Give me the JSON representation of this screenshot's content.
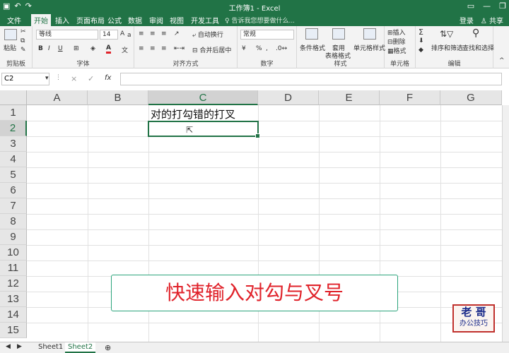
{
  "titlebar": {
    "save_icon": "save-icon",
    "undo": "↶",
    "redo": "↷",
    "title": "工作簿1 - Excel"
  },
  "tabs": [
    "文件",
    "开始",
    "插入",
    "页面布局",
    "公式",
    "数据",
    "审阅",
    "视图",
    "开发工具"
  ],
  "tellme": "告诉我您想要做什么...",
  "account": {
    "login": "登录",
    "share": "共享"
  },
  "ribbon": {
    "clipboard": {
      "paste": "粘贴",
      "label": "剪贴板"
    },
    "font": {
      "name": "等线",
      "size": "14",
      "bold": "B",
      "italic": "I",
      "underline": "U",
      "label": "字体",
      "font_color_letter": "A",
      "font_color_hex": "#e0222a"
    },
    "alignment": {
      "wrap": "自动换行",
      "merge": "合并后居中",
      "label": "对齐方式"
    },
    "number": {
      "format": "常规",
      "percent": "%",
      "comma": ",",
      "label": "数字"
    },
    "styles": {
      "cond": "条件格式",
      "table": "套用",
      "table2": "表格格式",
      "cell": "单元格样式",
      "label": "样式"
    },
    "cells": {
      "insert": "插入",
      "delete": "删除",
      "format": "格式",
      "label": "单元格"
    },
    "editing": {
      "sum": "Σ",
      "sort": "排序和筛选",
      "find": "查找和选择",
      "label": "编辑"
    }
  },
  "formula": {
    "namebox": "C2",
    "cancel": "×",
    "enter": "✓",
    "fx": "fx",
    "content": ""
  },
  "columns": [
    "A",
    "B",
    "C",
    "D",
    "E",
    "F",
    "G"
  ],
  "rows": [
    "1",
    "2",
    "3",
    "4",
    "5",
    "6",
    "7",
    "8",
    "9",
    "10",
    "11",
    "12",
    "13",
    "14",
    "15"
  ],
  "cells": {
    "C1": "对的打勾错的打叉"
  },
  "callout": "快速输入对勾与叉号",
  "logo": {
    "line1": "老 哥",
    "line2": "办公技巧"
  },
  "sheets": [
    "Sheet1",
    "Sheet2"
  ],
  "active_sheet": "Sheet2",
  "colors": {
    "accent": "#217346",
    "callout_border": "#2aa37a",
    "callout_text": "#e0222a"
  }
}
